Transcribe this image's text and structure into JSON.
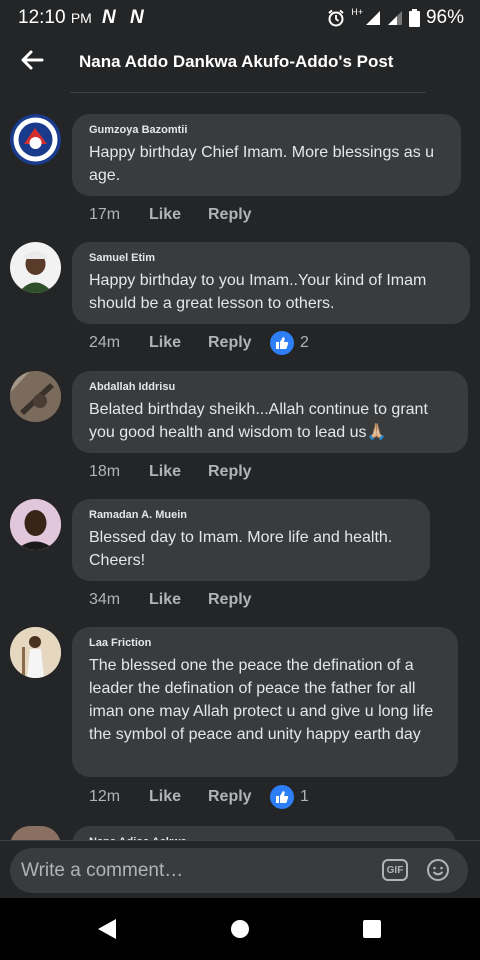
{
  "status": {
    "time": "12:10",
    "ampm": "PM",
    "network": "H+",
    "battery": "96%"
  },
  "header": {
    "title": "Nana Addo Dankwa Akufo-Addo's Post"
  },
  "comments": [
    {
      "name": "Gumzoya Bazomtii",
      "text": "Happy birthday Chief Imam. More blessings as u age.",
      "time": "17m",
      "like": "Like",
      "reply": "Reply"
    },
    {
      "name": "Samuel Etim",
      "text": "Happy birthday to you Imam..Your kind of Imam should be a great lesson to others.",
      "time": "24m",
      "like": "Like",
      "reply": "Reply",
      "reactions": "2"
    },
    {
      "name": "Abdallah Iddrisu",
      "text": "Belated birthday sheikh...Allah continue to grant you good health and wisdom to lead us🙏🏼",
      "time": "18m",
      "like": "Like",
      "reply": "Reply"
    },
    {
      "name": "Ramadan A. Muein",
      "text": "Blessed day to Imam. More life and health. Cheers!",
      "time": "34m",
      "like": "Like",
      "reply": "Reply"
    },
    {
      "name": "Laa Friction",
      "text": "The blessed one the peace the defination of a leader the defination of peace the father for all iman one may Allah protect u and give u long life the symbol of peace and unity happy earth day",
      "time": "12m",
      "like": "Like",
      "reply": "Reply",
      "reactions": "1"
    }
  ],
  "partial_comment": {
    "name": "Nana Adjoa Ackwa"
  },
  "composer": {
    "placeholder": "Write a comment…",
    "gif_label": "GIF"
  },
  "colors": {
    "background": "#242526",
    "bubble": "#3a3b3c",
    "like_blue": "#2e7ff7",
    "secondary_text": "#b0b3b8"
  }
}
